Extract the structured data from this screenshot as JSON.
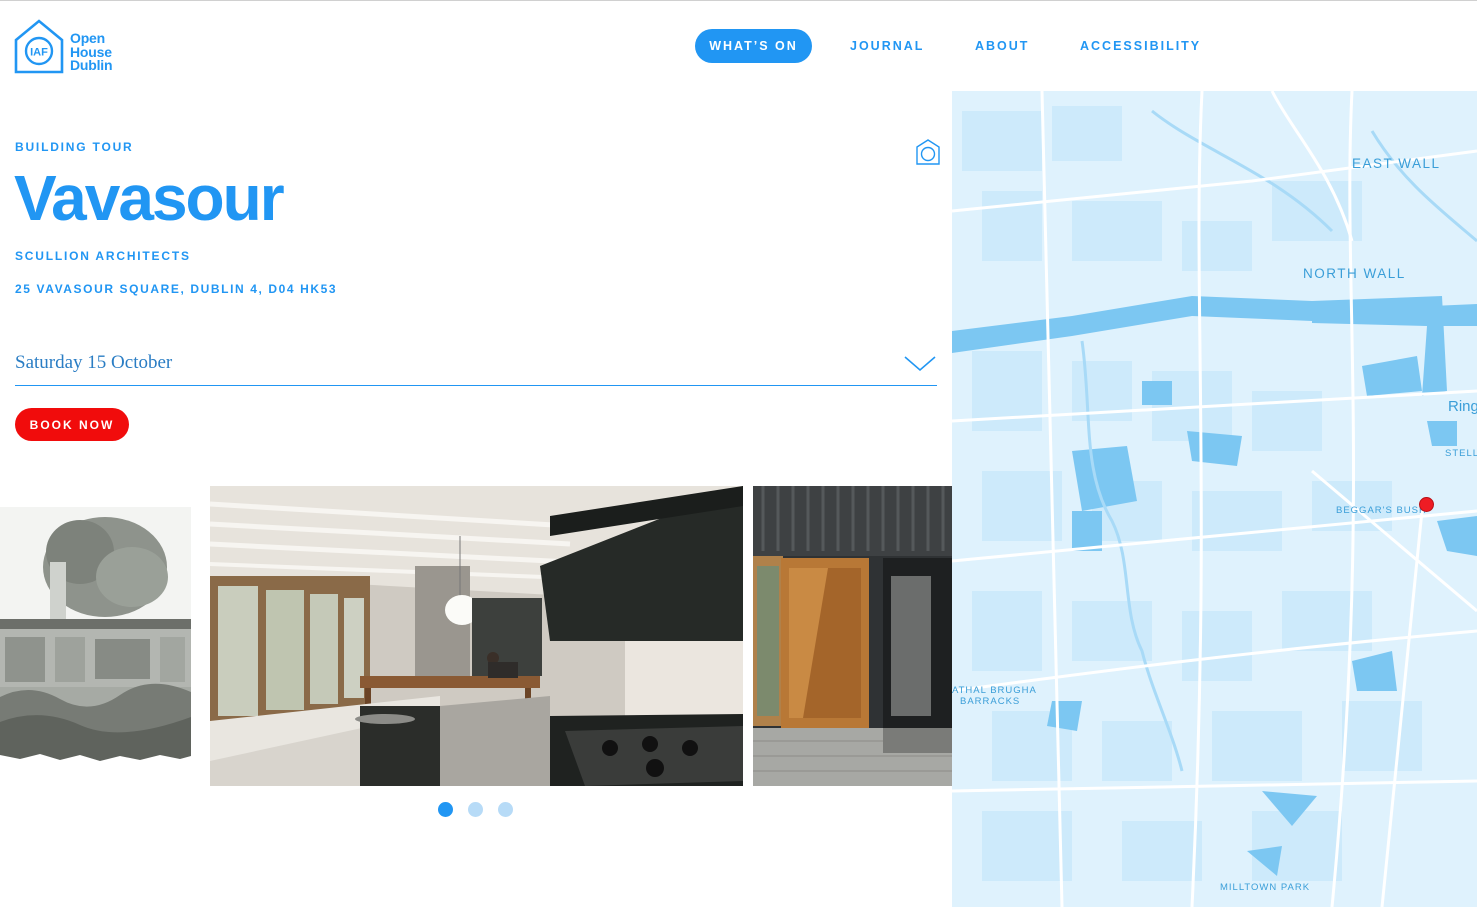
{
  "header": {
    "logo": {
      "mark": "IAF",
      "line1": "Open",
      "line2": "House",
      "line3": "Dublin"
    },
    "nav": [
      {
        "label": "WHAT’S ON",
        "active": true
      },
      {
        "label": "JOURNAL",
        "active": false
      },
      {
        "label": "ABOUT",
        "active": false
      },
      {
        "label": "ACCESSIBILITY",
        "active": false
      }
    ]
  },
  "event": {
    "category": "BUILDING TOUR",
    "title": "Vavasour",
    "architect": "SCULLION ARCHITECTS",
    "address": "25 VAVASOUR SQUARE, DUBLIN 4, D04 HK53",
    "type_icon": "house-outline-icon",
    "date_select": {
      "value": "Saturday 15 October",
      "icon": "chevron-down-icon"
    },
    "book_button": "BOOK NOW"
  },
  "carousel": {
    "slides": [
      {
        "description_icon": "sketch-illustration"
      },
      {
        "description_icon": "kitchen-photo"
      },
      {
        "description_icon": "timber-door-photo"
      }
    ],
    "dots": 3,
    "active_index": 0
  },
  "map": {
    "labels": {
      "east_wall": "EAST WALL",
      "north_wall": "NORTH WALL",
      "ring": "Ring",
      "stell": "STELL",
      "beggars_bush": "BEGGAR'S BUSH",
      "cathal_brugha_1": "ATHAL BRUGHA",
      "cathal_brugha_2": "BARRACKS",
      "milltown_park": "MILLTOWN PARK"
    },
    "pin_color": "#ee1c24"
  },
  "colors": {
    "brand_blue": "#2196f3",
    "book_red": "#f10c0c",
    "map_bg": "#dff2fd",
    "map_water": "#7cc7f2"
  }
}
